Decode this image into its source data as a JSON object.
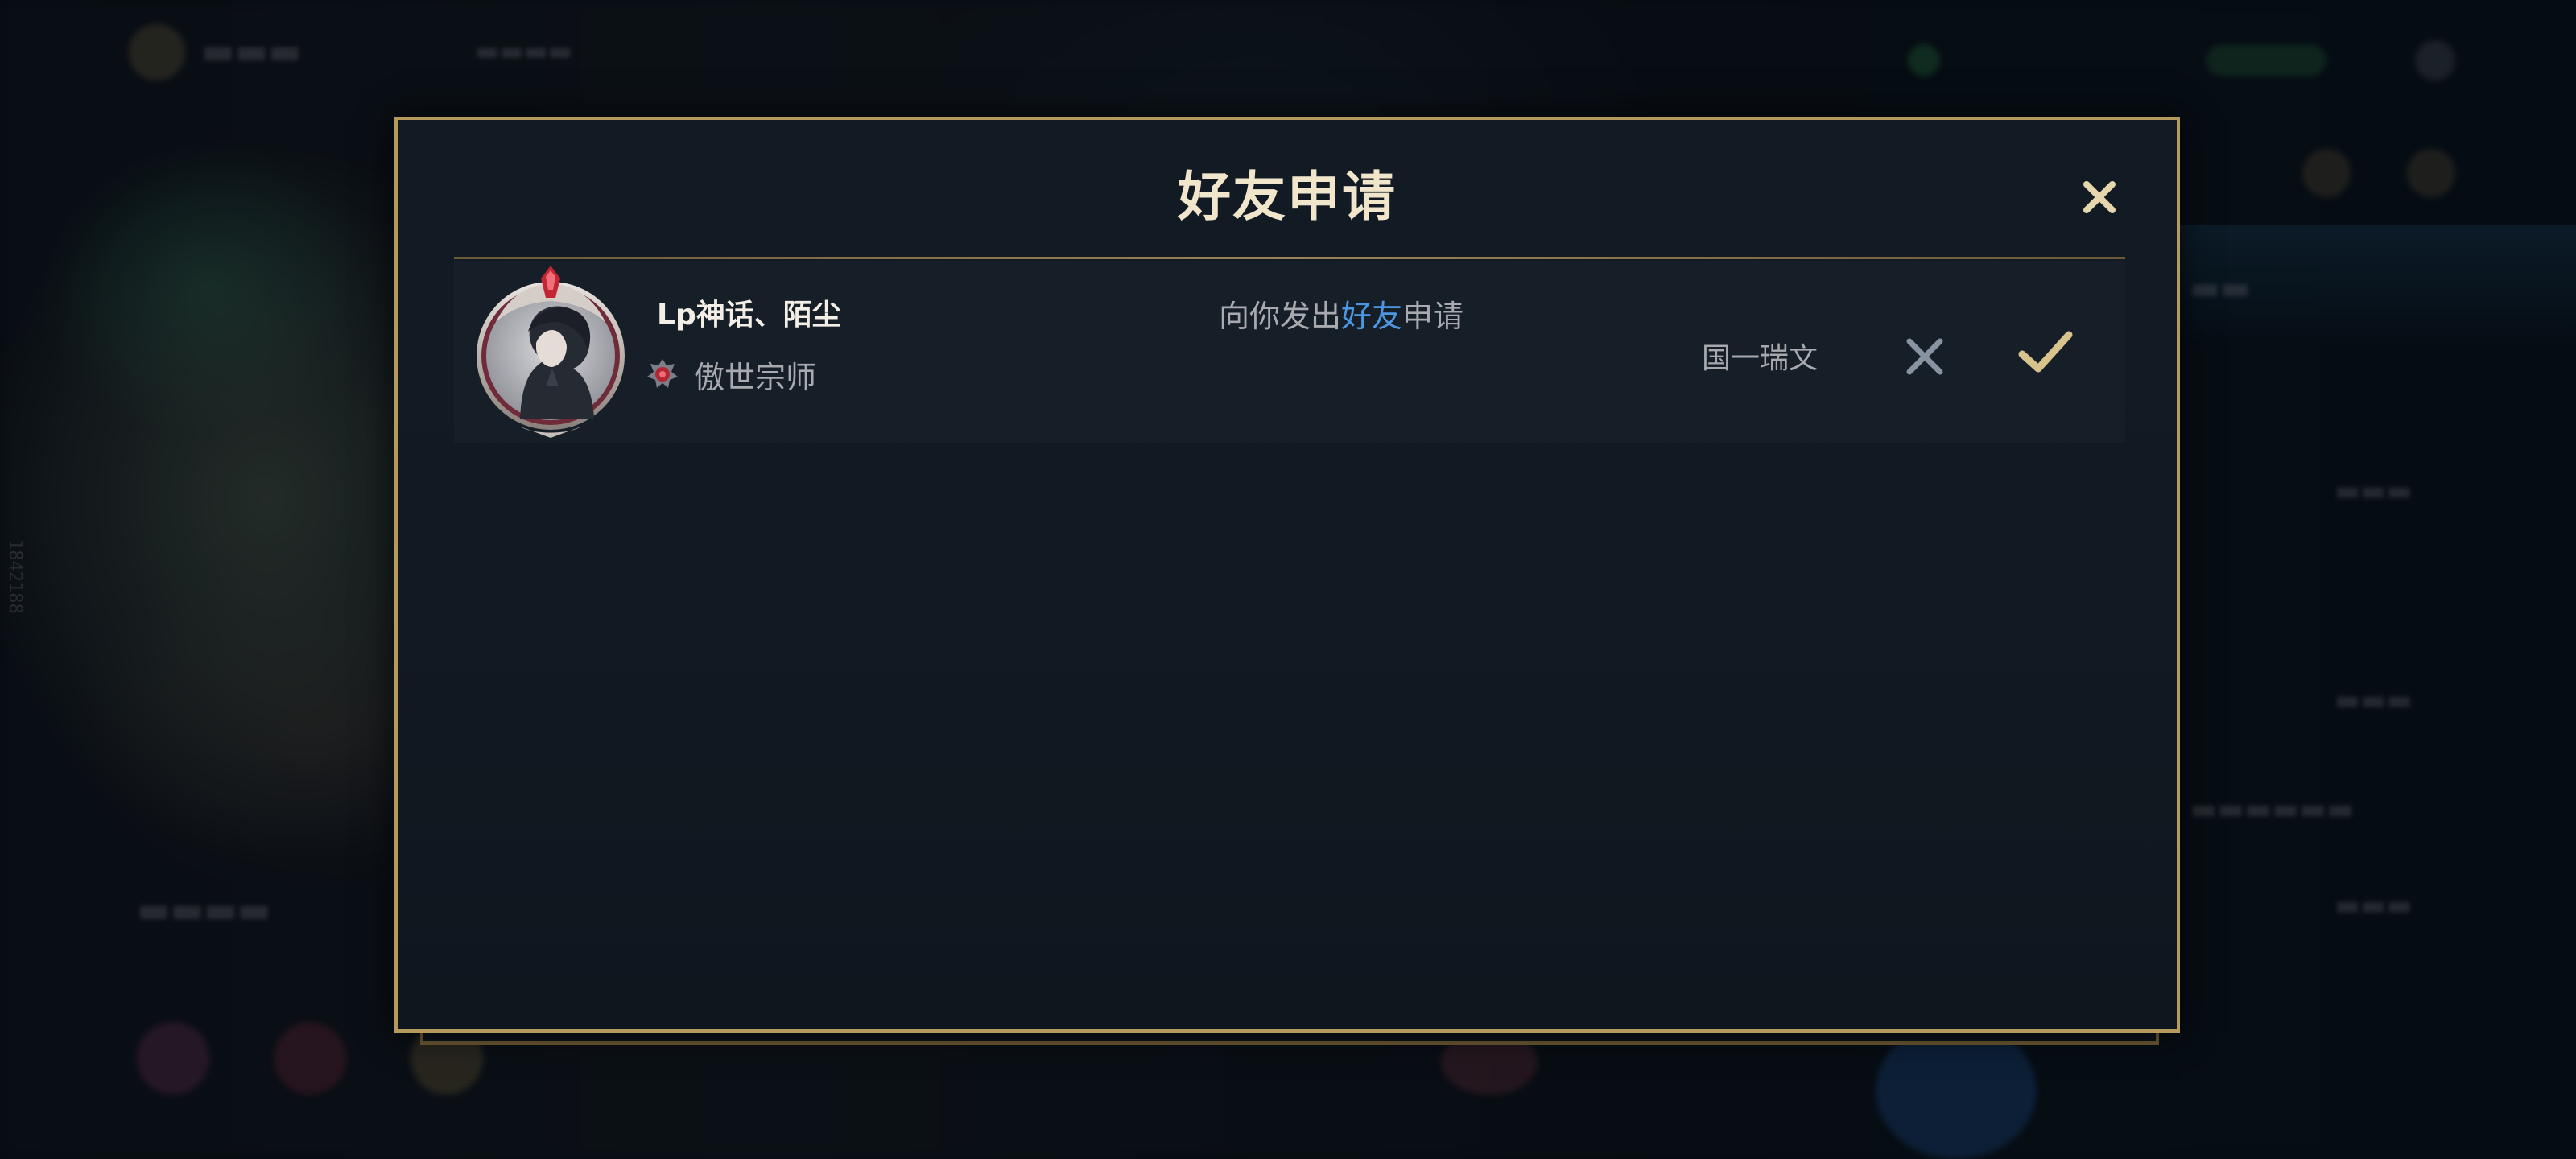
{
  "dialog": {
    "title": "好友申请"
  },
  "request": {
    "player_name": "Lp神话、陌尘",
    "rank": "傲世宗师",
    "message_prefix": "向你发出",
    "message_highlight": "好友",
    "message_suffix": "申请",
    "server": "国一瑞文"
  },
  "background": {
    "side_id": "1842188"
  },
  "icons": {
    "close": "close-icon",
    "decline": "x-icon",
    "accept": "checkmark-icon",
    "rank": "rank-emblem-icon",
    "avatar": "avatar-portrait"
  },
  "colors": {
    "gold_border": "#b69a5d",
    "title_text": "#f1e6cc",
    "highlight_blue": "#4c96e2",
    "accept_gold": "#d8c38d",
    "decline_gray": "#8793a1"
  }
}
